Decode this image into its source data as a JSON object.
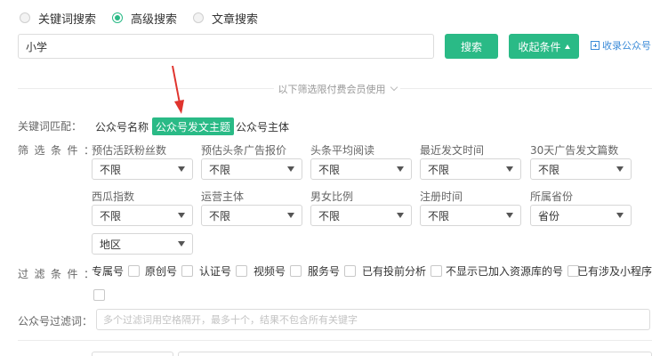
{
  "search_modes": [
    {
      "label": "关键词搜索",
      "selected": false
    },
    {
      "label": "高级搜索",
      "selected": true
    },
    {
      "label": "文章搜索",
      "selected": false
    }
  ],
  "search": {
    "value": "小学",
    "button": "搜索",
    "collapse": "收起条件",
    "collect_link": "收录公众号"
  },
  "divider": {
    "text": "以下筛选限付费会员使用"
  },
  "keyword_match": {
    "label": "关键词匹配：",
    "options": [
      "公众号名称",
      "公众号发文主题",
      "公众号主体"
    ],
    "selected": "公众号发文主题"
  },
  "filter": {
    "label": "筛选条件：",
    "fields": [
      {
        "title": "预估活跃粉丝数",
        "value": "不限"
      },
      {
        "title": "预估头条广告报价",
        "value": "不限"
      },
      {
        "title": "头条平均阅读",
        "value": "不限"
      },
      {
        "title": "最近发文时间",
        "value": "不限"
      },
      {
        "title": "30天广告发文篇数",
        "value": "不限"
      },
      {
        "title": "西瓜指数",
        "value": "不限"
      },
      {
        "title": "运营主体",
        "value": "不限"
      },
      {
        "title": "男女比例",
        "value": "不限"
      },
      {
        "title": "注册时间",
        "value": "不限"
      },
      {
        "title": "所属省份",
        "value": "省份"
      }
    ],
    "region": "地区"
  },
  "pass_filter": {
    "label": "过滤条件：",
    "options": [
      "专属号",
      "原创号",
      "认证号",
      "视频号",
      "服务号",
      "已有投前分析",
      "不显示已加入资源库的号",
      "已有涉及小程序"
    ]
  },
  "filter_words": {
    "label": "公众号过滤词：",
    "placeholder": "多个过滤词用空格隔开，最多十个，结果不包含所有关键字"
  },
  "colors": {
    "accent": "#2aba86",
    "link": "#3b8bd8",
    "arrow": "#e0342e"
  }
}
